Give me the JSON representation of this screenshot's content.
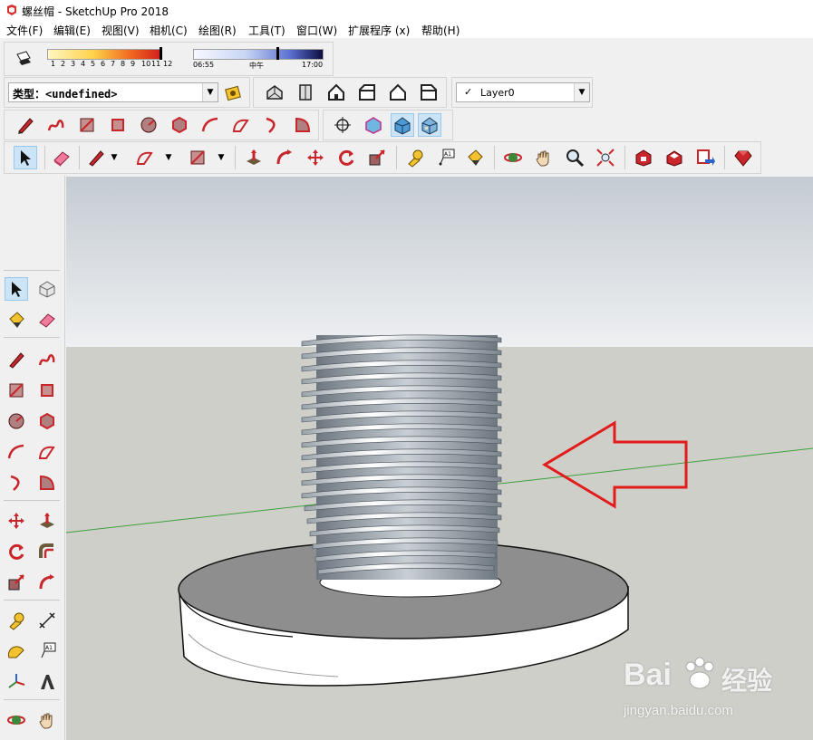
{
  "window": {
    "title": "螺丝帽 - SketchUp Pro 2018",
    "icon": "sketchup-logo-icon"
  },
  "menu": [
    {
      "label": "文件(F)"
    },
    {
      "label": "编辑(E)"
    },
    {
      "label": "视图(V)"
    },
    {
      "label": "相机(C)"
    },
    {
      "label": "绘图(R)"
    },
    {
      "label": "工具(T)"
    },
    {
      "label": "窗口(W)"
    },
    {
      "label": "扩展程序 (x)"
    },
    {
      "label": "帮助(H)"
    }
  ],
  "shadow": {
    "month_ticks": [
      "1",
      "2",
      "3",
      "4",
      "5",
      "6",
      "7",
      "8",
      "9",
      "10",
      "11",
      "12"
    ],
    "time_start": "06:55",
    "time_mid": "中午",
    "time_end": "17:00"
  },
  "type_selector": {
    "label": "类型：",
    "value": "<undefined>"
  },
  "layer_selector": {
    "check": "✓",
    "value": "Layer0"
  },
  "colors": {
    "sky": "#d6dbe0",
    "ground": "#cfcfca",
    "accent": "#e21b1b",
    "axis_green": "#3ca13c"
  },
  "icons": {
    "views": [
      "iso-view-icon",
      "top-view-icon",
      "front-view-icon",
      "right-view-icon",
      "back-view-icon",
      "left-view-icon"
    ],
    "draw": [
      "pencil-icon",
      "freehand-icon",
      "rectangle-icon",
      "rotated-rectangle-icon",
      "circle-icon",
      "polygon-icon",
      "arc-icon",
      "two-point-arc-icon",
      "three-point-arc-icon",
      "pie-icon"
    ],
    "camera": [
      "position-camera-icon",
      "x-ray-icon",
      "shaded-icon",
      "textured-icon"
    ],
    "main": [
      "select-icon",
      "eraser-icon",
      "pencil-icon",
      "arc-icon",
      "rectangle-icon",
      "push-pull-icon",
      "follow-me-icon",
      "move-icon",
      "rotate-icon",
      "scale-icon",
      "tape-measure-icon",
      "text-icon",
      "paint-bucket-icon",
      "orbit-icon",
      "pan-icon",
      "zoom-icon",
      "zoom-extents-icon",
      "warehouse-icon",
      "extension-warehouse-icon",
      "send-to-layout-icon",
      "ruby-icon"
    ]
  },
  "annotation": {
    "arrow": "red-arrow-annotation"
  },
  "watermark": {
    "brand": "Bai",
    "brand2": "经验",
    "url": "jingyan.baidu.com"
  }
}
